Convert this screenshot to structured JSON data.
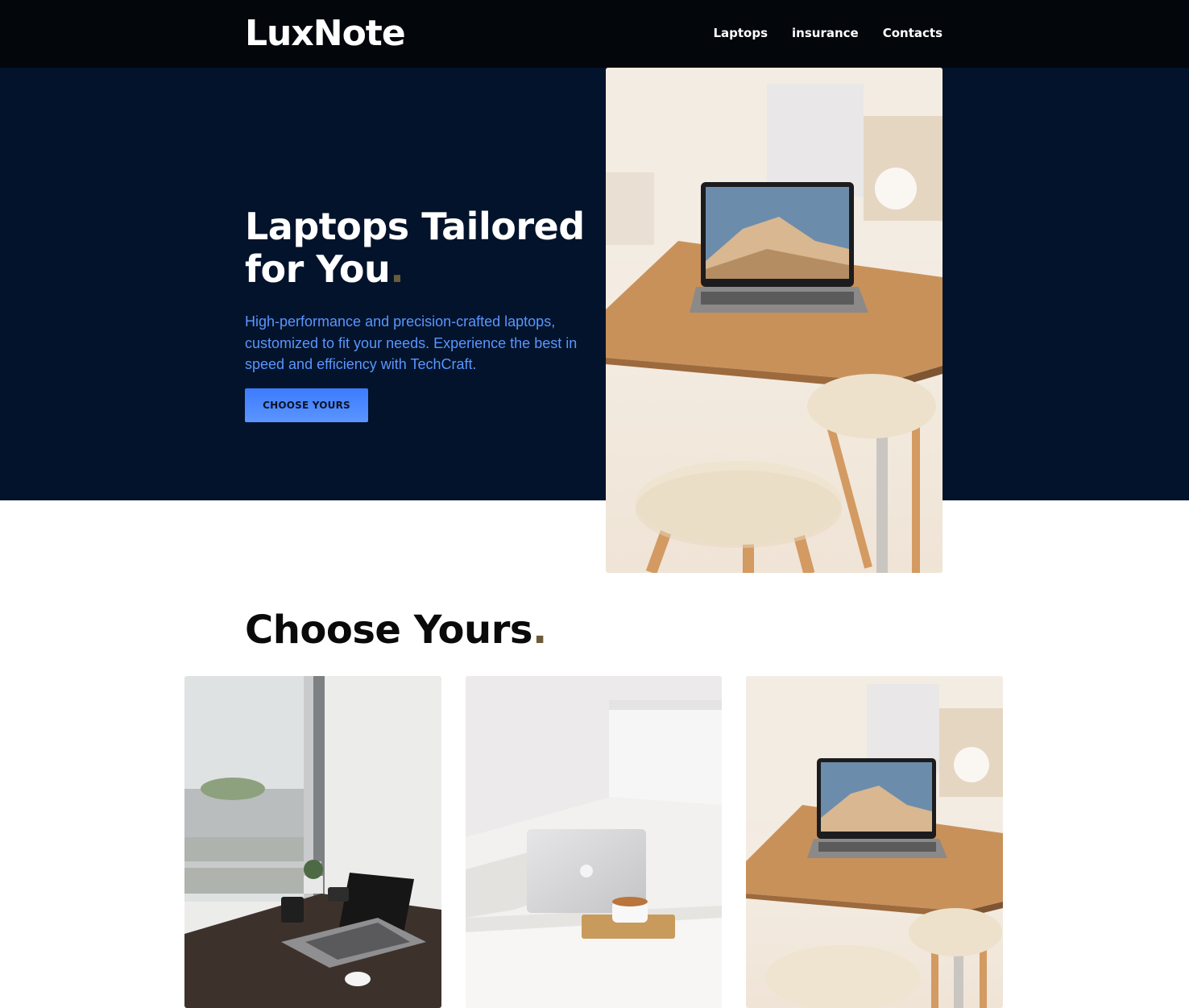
{
  "brand": {
    "logo": "LuxNote"
  },
  "nav": {
    "links": [
      {
        "label": "Laptops"
      },
      {
        "label": "insurance"
      },
      {
        "label": "Contacts"
      }
    ]
  },
  "hero": {
    "title_line": "Laptops Tailored for You",
    "title_dot": ".",
    "description": "High-performance and precision-crafted laptops, customized to fit your needs. Experience the best in speed and efficiency with TechCraft.",
    "cta_label": "CHOOSE YOURS"
  },
  "choose": {
    "title": "Choose Yours",
    "title_dot": "."
  },
  "colors": {
    "nav_bg": "#03060b",
    "hero_bg": "#02132b",
    "accent_blue": "#5b95ff",
    "button_blue": "#3d7bff",
    "dot_accent": "#6b5b3a"
  }
}
